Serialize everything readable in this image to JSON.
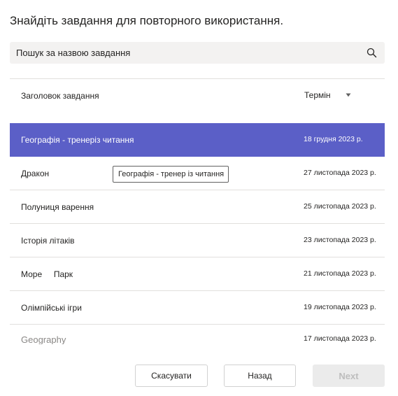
{
  "dialog": {
    "title": "Знайдіть завдання для повторного використання."
  },
  "search": {
    "placeholder": "Пошук за назвою завдання",
    "icon": "search-icon"
  },
  "table": {
    "col_title": "Заголовок завдання",
    "col_due": "Термін",
    "sort_icon": "caret-down-icon",
    "rows": [
      {
        "title": "Географія - тренеріз читання",
        "due": "18 грудня 2023 р.",
        "selected": true
      },
      {
        "title": "Дракон",
        "due": "27 листопада 2023 р."
      },
      {
        "title": "Полуниця варення",
        "due": "25 листопада 2023 р."
      },
      {
        "title": "Історія літаків",
        "due": "23 листопада 2023 р."
      },
      {
        "title": "Море     Парк",
        "due": "21 листопада 2023 р."
      },
      {
        "title": "Олімпійські ігри",
        "due": "19 листопада 2023 р."
      },
      {
        "title": "Geography",
        "due": "17 листопада 2023 р."
      }
    ]
  },
  "tooltip": {
    "text": "Географія - тренер із читання"
  },
  "footer": {
    "cancel_label": "Скасувати",
    "back_label": "Назад",
    "next_label": "Next"
  },
  "colors": {
    "accent": "#5b5fc7",
    "row_divider": "#e1dfdd",
    "search_bg": "#f3f2f1"
  }
}
